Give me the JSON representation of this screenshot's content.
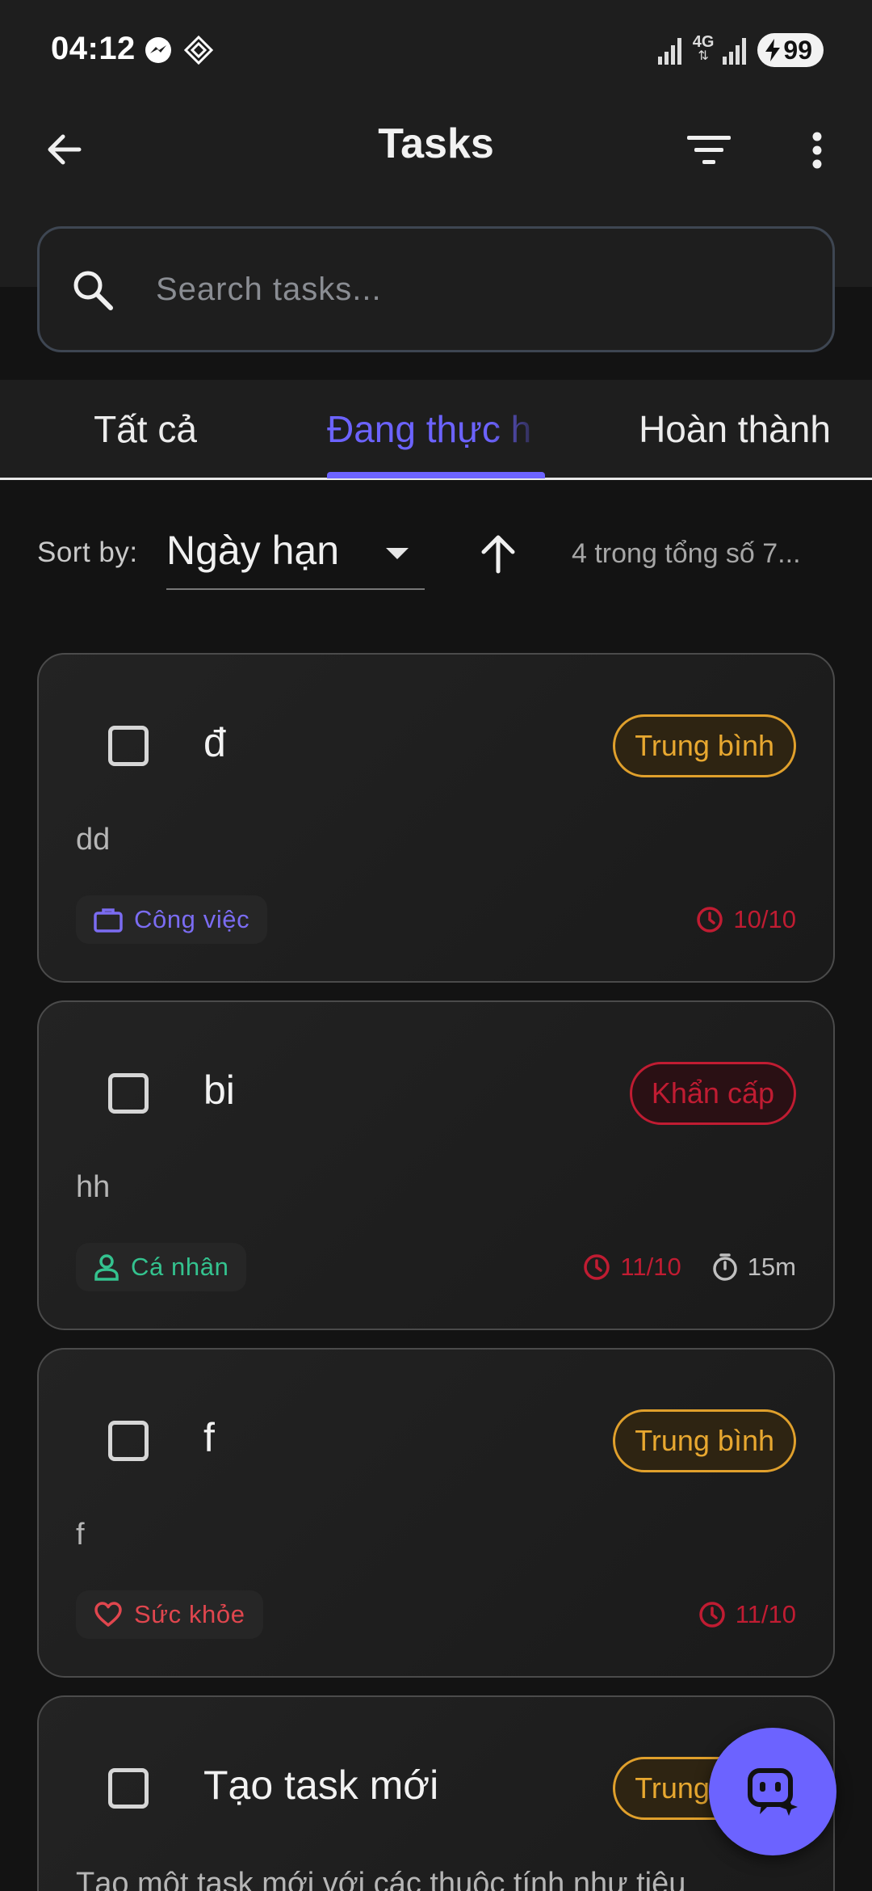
{
  "status_bar": {
    "time": "04:12",
    "network": "4G",
    "battery": "99"
  },
  "app_bar": {
    "title": "Tasks"
  },
  "search": {
    "placeholder": "Search tasks..."
  },
  "tabs": [
    {
      "label": "Tất cả",
      "active": false
    },
    {
      "label": "Đang thực h",
      "active": true
    },
    {
      "label": "Hoàn thành",
      "active": false
    }
  ],
  "sort": {
    "label": "Sort by:",
    "value": "Ngày hạn",
    "count_text": "4 trong tổng số 7..."
  },
  "tasks": [
    {
      "title": "đ",
      "priority": "Trung bình",
      "description": "dd",
      "category": "Công việc",
      "due": "10/10"
    },
    {
      "title": "bi",
      "priority": "Khẩn cấp",
      "description": "hh",
      "category": "Cá nhân",
      "due": "11/10",
      "duration": "15m"
    },
    {
      "title": "f",
      "priority": "Trung bình",
      "description": "f",
      "category": "Sức khỏe",
      "due": "11/10"
    },
    {
      "title": "Tạo task mới",
      "priority": "Trung bình",
      "description": "Tạo một task mới với các thuộc tính như tiêu"
    }
  ],
  "colors": {
    "accent": "#6c63ff",
    "medium": "#e8a830",
    "urgent": "#c01c32",
    "work": "#7b6cf2",
    "personal": "#34c38f",
    "health": "#e0464e"
  }
}
